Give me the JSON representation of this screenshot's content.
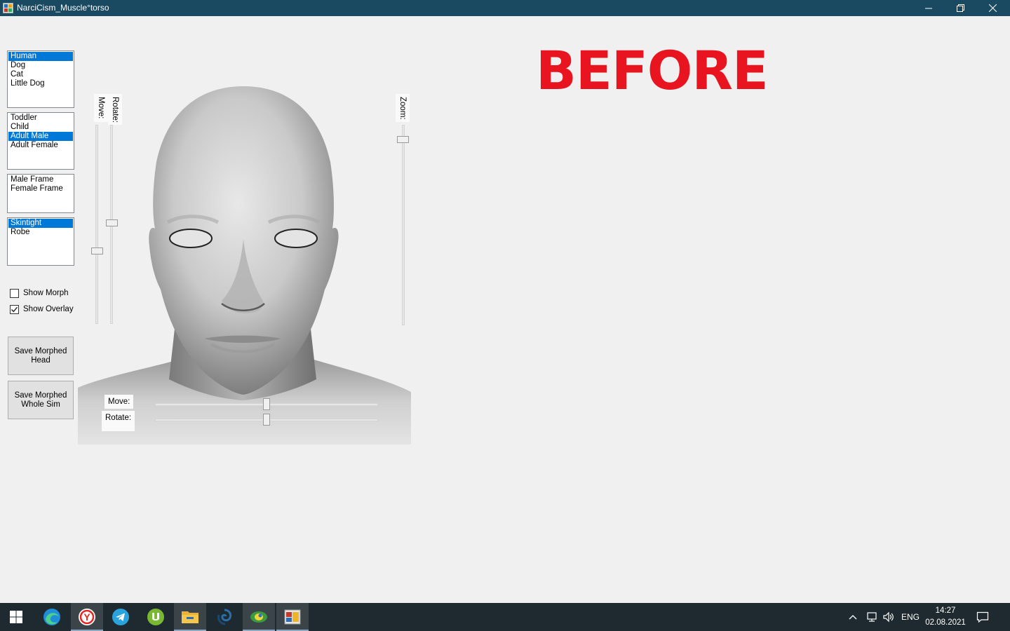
{
  "window": {
    "title": "NarciCism_Muscle°torso"
  },
  "lists": {
    "species": {
      "items": [
        "Human",
        "Dog",
        "Cat",
        "Little Dog"
      ],
      "selected": "Human"
    },
    "age": {
      "items": [
        "Toddler",
        "Child",
        "Adult Male",
        "Adult Female"
      ],
      "selected": "Adult Male"
    },
    "frame": {
      "items": [
        "Male Frame",
        "Female Frame"
      ],
      "selected": null
    },
    "clothing": {
      "items": [
        "Skintight",
        "Robe"
      ],
      "selected": "Skintight"
    }
  },
  "checkboxes": {
    "show_morph": {
      "label": "Show Morph",
      "checked": false
    },
    "show_overlay": {
      "label": "Show Overlay",
      "checked": true
    }
  },
  "buttons": {
    "save_head": "Save Morphed\nHead",
    "save_whole": "Save Morphed\nWhole Sim"
  },
  "sliders": {
    "vertical_move_label": "Move:",
    "vertical_rotate_label": "Rotate:",
    "zoom_label": "Zoom:",
    "horizontal_move_label": "Move:",
    "horizontal_rotate_label": "Rotate:"
  },
  "overlay_text": "BEFORE",
  "colors": {
    "titlebar": "#1a4a62",
    "selection": "#0078d7",
    "before_text": "#e8141f",
    "taskbar": "#1f2a30"
  },
  "taskbar": {
    "apps": [
      "windows-start",
      "edge",
      "yandex-browser",
      "telegram",
      "utorrent",
      "file-explorer",
      "app-swirl",
      "app-globe",
      "narcicism-app"
    ],
    "language": "ENG",
    "time": "14:27",
    "date": "02.08.2021"
  }
}
